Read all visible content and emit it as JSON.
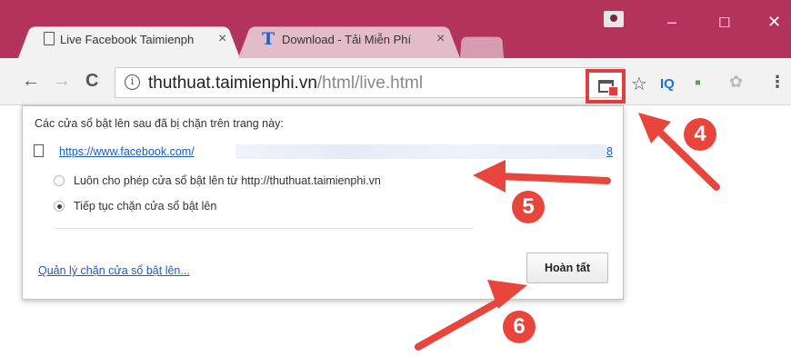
{
  "browser": {
    "tabs": [
      {
        "title": "Live Facebook Taimienph",
        "close": "×",
        "icon": "page-icon",
        "active": true
      },
      {
        "title": "Download - Tải Miễn Phí",
        "close": "×",
        "icon": "t-brand-icon",
        "active": false
      }
    ],
    "window_controls": {
      "minimize": "–",
      "maximize": "☐",
      "close": "✕"
    },
    "nav": {
      "back": "←",
      "forward": "→",
      "reload": "C"
    },
    "omnibox": {
      "info_icon": "i",
      "url_host": "thuthuat.taimienphi.vn",
      "url_path": "/html/live.html"
    },
    "toolbar_icons": {
      "star": "☆",
      "iq": "IQ",
      "ext1": "▪",
      "ext2": "✿",
      "menu": "⋮"
    }
  },
  "popup": {
    "heading": "Các cửa sổ bật lên sau đã bị chặn trên trang này:",
    "blocked_link_start": "https://www.facebook.com/",
    "blocked_link_end": "8",
    "options": [
      {
        "label": "Luôn cho phép cửa sổ bật lên từ http://thuthuat.taimienphi.vn",
        "checked": false
      },
      {
        "label": "Tiếp tục chặn cửa sổ bật lên",
        "checked": true
      }
    ],
    "manage_link": "Quản lý chặn cửa sổ bật lên...",
    "done_button": "Hoàn tất"
  },
  "annotations": {
    "callouts": [
      "4",
      "5",
      "6"
    ],
    "color": "#e8453c"
  },
  "colors": {
    "titlebar": "#b3335a",
    "link": "#1a5bc4",
    "highlight": "#e03d3d"
  }
}
